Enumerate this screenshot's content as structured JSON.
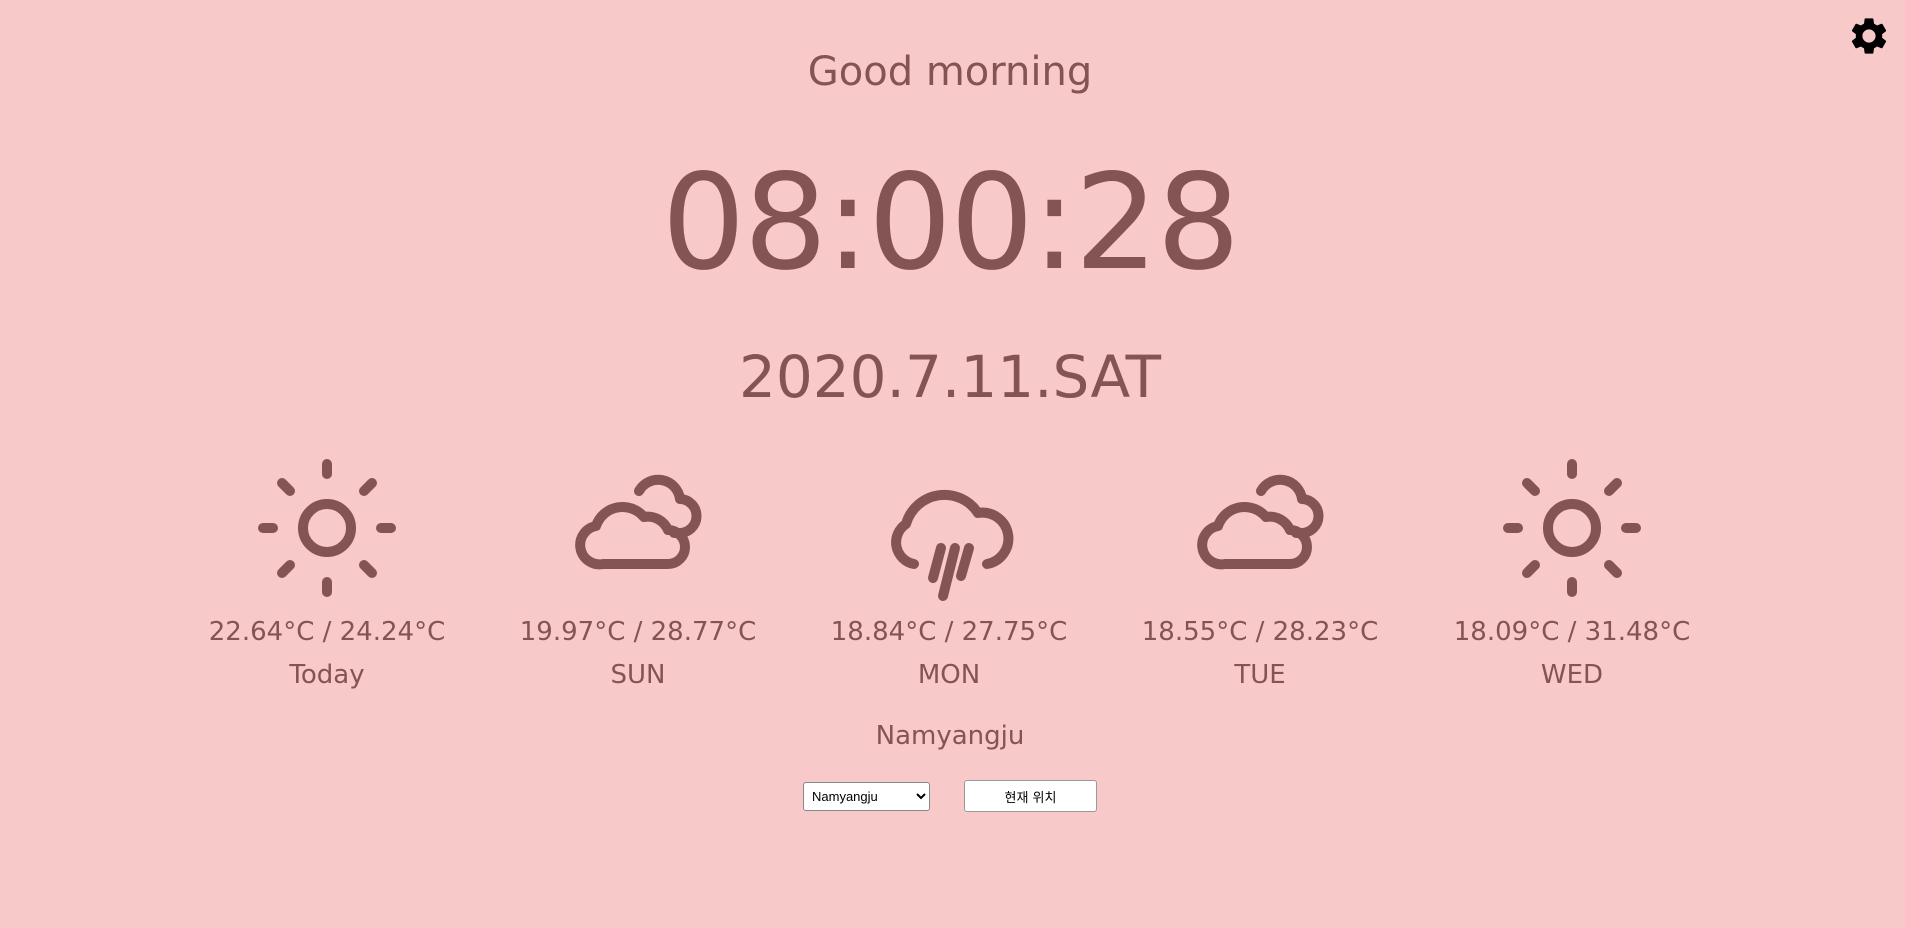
{
  "greeting": "Good morning",
  "clock": "08:00:28",
  "date": "2020.7.11.SAT",
  "colors": {
    "background": "#f7c9c9",
    "text": "#845455",
    "settings_icon": "#000000"
  },
  "settings": {
    "icon": "gear-icon"
  },
  "forecast": [
    {
      "icon": "sun-icon",
      "temps": "22.64°C / 24.24°C",
      "label": "Today"
    },
    {
      "icon": "partly-cloudy-icon",
      "temps": "19.97°C / 28.77°C",
      "label": "SUN"
    },
    {
      "icon": "rain-cloud-icon",
      "temps": "18.84°C / 27.75°C",
      "label": "MON"
    },
    {
      "icon": "partly-cloudy-icon",
      "temps": "18.55°C / 28.23°C",
      "label": "TUE"
    },
    {
      "icon": "sun-icon",
      "temps": "18.09°C / 31.48°C",
      "label": "WED"
    }
  ],
  "city": "Namyangju",
  "location_select": {
    "selected": "Namyangju"
  },
  "current_location_button": "현재 위치"
}
